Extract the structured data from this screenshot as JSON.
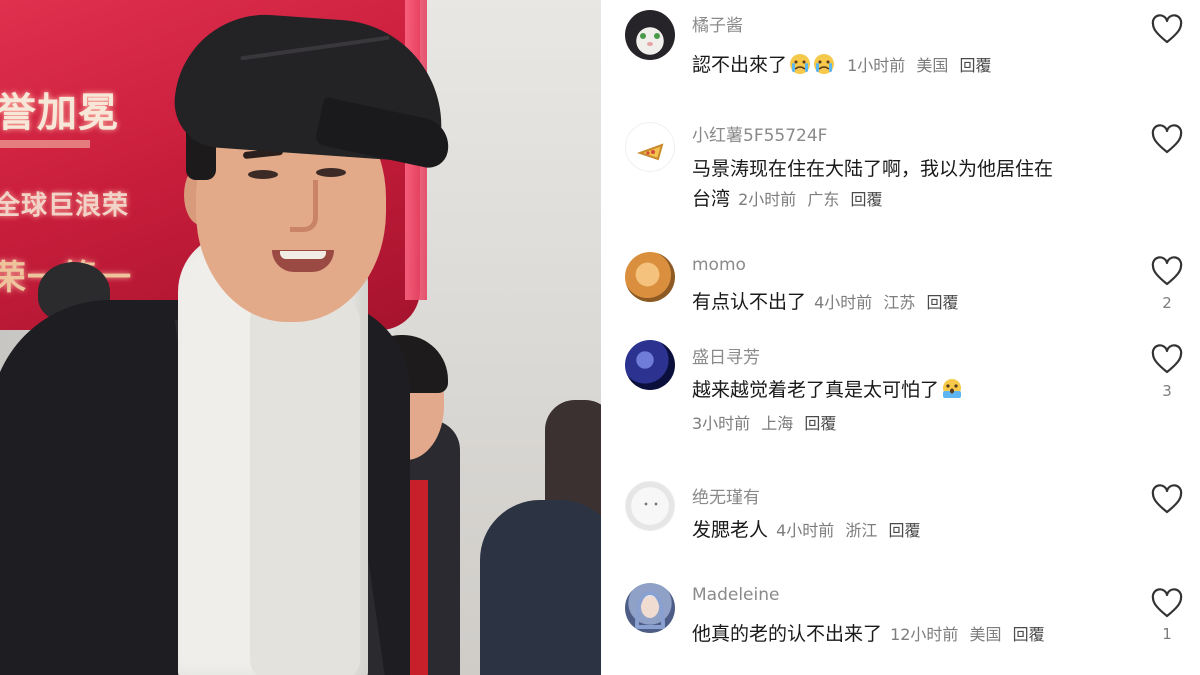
{
  "photo": {
    "led_text_1": "誉加冕",
    "led_text_2": "全球巨浪荣",
    "led_text_3": "荣一第一"
  },
  "comments": [
    {
      "username": "橘子酱",
      "text_lines": [
        "認不出來了"
      ],
      "emojis": [
        "crying-face-emoji",
        "crying-face-emoji"
      ],
      "time": "1小时前",
      "location": "美国",
      "reply": "回覆",
      "likes": "",
      "avatar": "cat-avatar"
    },
    {
      "username": "小红薯5F55724F",
      "text_lines": [
        "马景涛现在住在大陆了啊，我以为他居住在",
        "台湾"
      ],
      "emojis": [],
      "time": "2小时前",
      "location": "广东",
      "reply": "回覆",
      "likes": "",
      "avatar": "pizza-avatar"
    },
    {
      "username": "momo",
      "text_lines": [
        "有点认不出了"
      ],
      "emojis": [],
      "time": "4小时前",
      "location": "江苏",
      "reply": "回覆",
      "likes": "2",
      "avatar": "bread-avatar"
    },
    {
      "username": "盛日寻芳",
      "text_lines": [
        "越来越觉着老了真是太可怕了"
      ],
      "emojis": [
        "scared-face-emoji"
      ],
      "time": "3小时前",
      "location": "上海",
      "reply": "回覆",
      "likes": "3",
      "avatar": "blue-art-avatar"
    },
    {
      "username": "绝无瑾有",
      "text_lines": [
        "发腮老人"
      ],
      "emojis": [],
      "time": "4小时前",
      "location": "浙江",
      "reply": "回覆",
      "likes": "",
      "avatar": "white-face-avatar"
    },
    {
      "username": "Madeleine",
      "text_lines": [
        "他真的老的认不出来了"
      ],
      "emojis": [],
      "time": "12小时前",
      "location": "美国",
      "reply": "回覆",
      "likes": "1",
      "avatar": "anime-girl-avatar"
    }
  ],
  "colors": {
    "username": "#8a8a8a",
    "text": "#1a1a1a",
    "meta": "#7d7d7d",
    "heart": "#333333"
  }
}
